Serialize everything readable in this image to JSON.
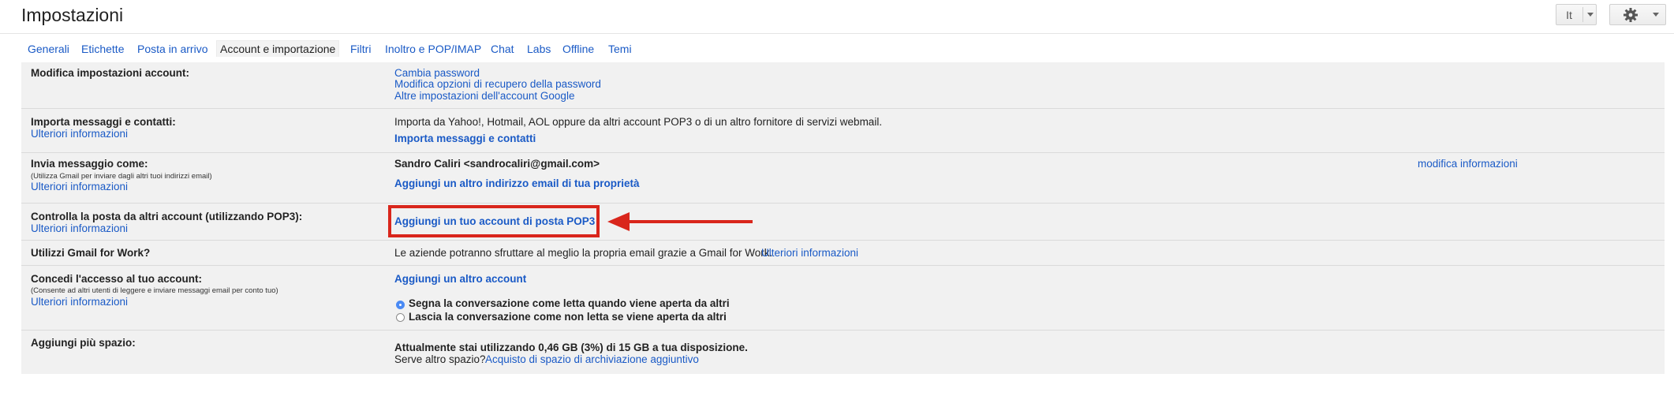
{
  "page": {
    "title": "Impostazioni"
  },
  "toolbar": {
    "input_tool_label": "It",
    "settings_icon": "gear-icon"
  },
  "tabs": [
    {
      "label": "Generali"
    },
    {
      "label": "Etichette"
    },
    {
      "label": "Posta in arrivo"
    },
    {
      "label": "Account e importazione",
      "active": true
    },
    {
      "label": "Filtri"
    },
    {
      "label": "Inoltro e POP/IMAP"
    },
    {
      "label": "Chat"
    },
    {
      "label": "Labs"
    },
    {
      "label": "Offline"
    },
    {
      "label": "Temi"
    }
  ],
  "sections": {
    "account_settings": {
      "label": "Modifica impostazioni account:",
      "links": [
        "Cambia password",
        "Modifica opzioni di recupero della password",
        "Altre impostazioni dell'account Google"
      ]
    },
    "import": {
      "label": "Importa messaggi e contatti:",
      "more": "Ulteriori informazioni",
      "description": "Importa da Yahoo!, Hotmail, AOL oppure da altri account POP3 o di un altro fornitore di servizi webmail.",
      "action": "Importa messaggi e contatti"
    },
    "send_as": {
      "label": "Invia messaggio come:",
      "note": "(Utilizza Gmail per inviare dagli altri tuoi indirizzi email)",
      "more": "Ulteriori informazioni",
      "address": "Sandro Caliri <sandrocaliri@gmail.com>",
      "edit": "modifica informazioni",
      "action": "Aggiungi un altro indirizzo email di tua proprietà"
    },
    "check_mail": {
      "label": "Controlla la posta da altri account (utilizzando POP3):",
      "more": "Ulteriori informazioni",
      "action": "Aggiungi un tuo account di posta POP3"
    },
    "for_work": {
      "label": "Utilizzi Gmail for Work?",
      "description": "Le aziende potranno sfruttare al meglio la propria email grazie a Gmail for Work.",
      "more": "Ulteriori informazioni"
    },
    "grant_access": {
      "label": "Concedi l'accesso al tuo account:",
      "note": "(Consente ad altri utenti di leggere e inviare messaggi email per conto tuo)",
      "more": "Ulteriori informazioni",
      "action": "Aggiungi un altro account",
      "options": [
        "Segna la conversazione come letta quando viene aperta da altri",
        "Lascia la conversazione come non letta se viene aperta da altri"
      ],
      "selected_option": 0
    },
    "storage": {
      "label": "Aggiungi più spazio:",
      "usage": "Attualmente stai utilizzando 0,46 GB (3%) di 15 GB a tua disposizione.",
      "question": "Serve altro spazio?",
      "link": "Acquisto di spazio di archiviazione aggiuntivo"
    }
  },
  "annotation": {
    "color": "#d9261c"
  }
}
